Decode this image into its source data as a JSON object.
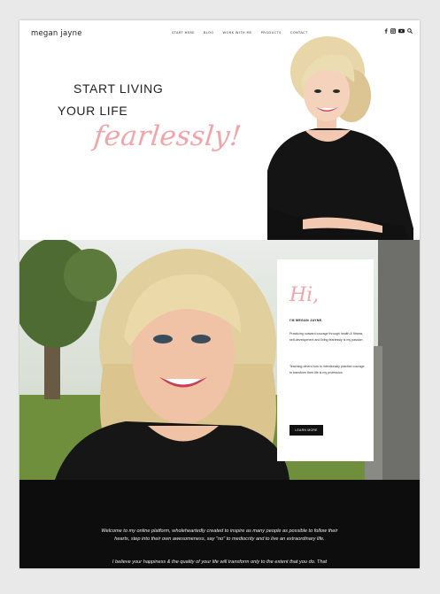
{
  "header": {
    "logo": "megan jayne",
    "nav": [
      "START HERE",
      "BLOG",
      "WORK WITH ME",
      "PRODUCTS",
      "CONTACT"
    ],
    "social_icons": [
      "facebook-icon",
      "instagram-icon",
      "youtube-icon",
      "search-icon"
    ]
  },
  "hero": {
    "line1": "START LIVING",
    "line2": "YOUR LIFE",
    "script": "fearlessly!"
  },
  "intro": {
    "greeting": "Hi,",
    "name": "I'M MEGAN JAYNE.",
    "para1": "Practicing outward courage through health & fitness, self-development and living fearlessly is my passion",
    "para2": "Teaching others how to intentionally practice courage to transform their life is my profession",
    "button": "LEARN MORE"
  },
  "welcome": {
    "text": "Welcome to my online platform, wholeheartedly created to inspire as many people as possible to follow their hearts, step into their own awesomeness, say \"no\" to mediocrity and to live an extraordinary life.",
    "believe": "I believe your happiness & the quality of your life will transform only to the extent that you do. That"
  },
  "colors": {
    "accent": "#f0a5a9",
    "dark": "#0d0d0d",
    "background": "#e9e9e9"
  }
}
